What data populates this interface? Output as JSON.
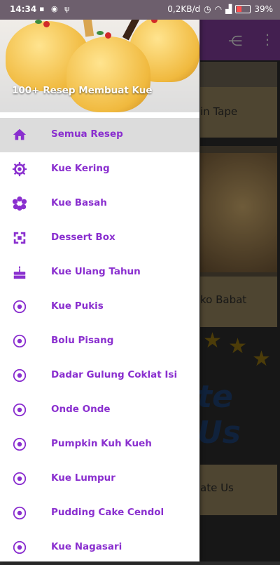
{
  "statusbar": {
    "time": "14:34",
    "net_speed": "0,2KB/d",
    "battery": "39%"
  },
  "drawer": {
    "header_title": "100+ Resep Membuat Kue",
    "items": [
      {
        "label": "Semua Resep",
        "icon": "home-icon"
      },
      {
        "label": "Kue Kering",
        "icon": "gear-icon"
      },
      {
        "label": "Kue Basah",
        "icon": "flower-icon"
      },
      {
        "label": "Dessert Box",
        "icon": "box-icon"
      },
      {
        "label": "Kue Ulang Tahun",
        "icon": "cake-icon"
      },
      {
        "label": "Kue Pukis",
        "icon": "radio-icon"
      },
      {
        "label": "Bolu Pisang",
        "icon": "radio-icon"
      },
      {
        "label": "Dadar Gulung Coklat Isi",
        "icon": "radio-icon"
      },
      {
        "label": "Onde Onde",
        "icon": "radio-icon"
      },
      {
        "label": "Pumpkin Kuh Kueh",
        "icon": "radio-icon"
      },
      {
        "label": "Kue Lumpur",
        "icon": "radio-icon"
      },
      {
        "label": "Pudding Cake Cendol",
        "icon": "radio-icon"
      },
      {
        "label": "Kue Nagasari",
        "icon": "radio-icon"
      }
    ]
  },
  "background": {
    "card1_label": "in Tape",
    "card2_label": "ko Babat",
    "rate_big": "te Us",
    "rate_button": "ate Us"
  },
  "colors": {
    "accent": "#8a2fcf",
    "appbar": "#7a3a92",
    "active_bg": "#dcdcdc"
  }
}
